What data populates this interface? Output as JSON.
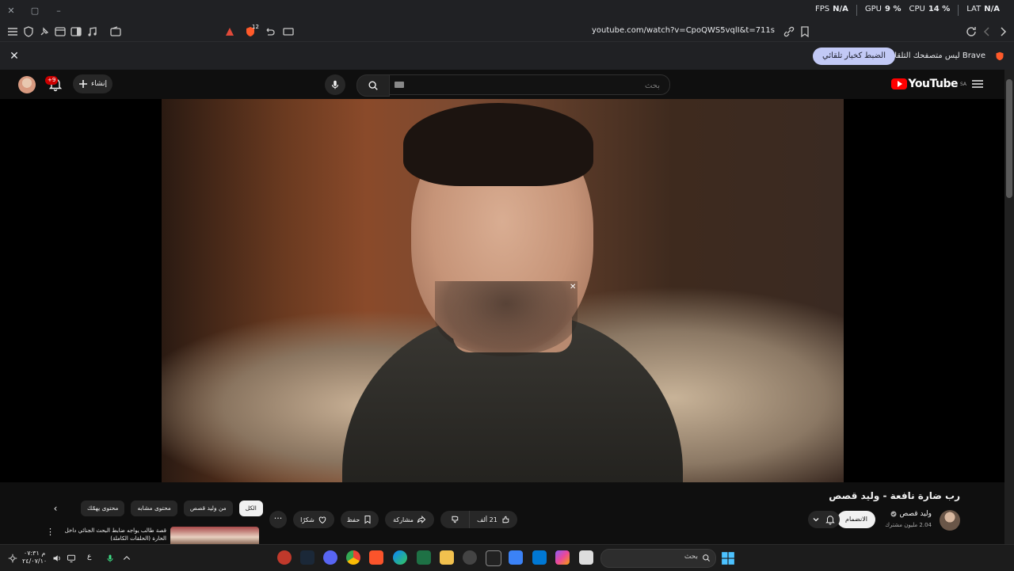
{
  "titlebar": {
    "perf": [
      {
        "label": "FPS",
        "value": "N/A"
      },
      {
        "label": "GPU",
        "value": "9 %"
      },
      {
        "label": "CPU",
        "value": "14 %"
      },
      {
        "label": "LAT",
        "value": "N/A"
      }
    ]
  },
  "toolbar": {
    "url": "youtube.com/watch?v=CpoQWS5vqlI&t=711s",
    "badge_count": "12"
  },
  "infobar": {
    "message": "Brave ليس متصفحك التلقائي.",
    "button_label": "الضبط كخيار تلقائي"
  },
  "yt_header": {
    "logo_text": "YouTube",
    "logo_region": "SA",
    "search_placeholder": "بحث",
    "create_label": "إنشاء",
    "notification_count": "+9"
  },
  "video": {
    "title": "رب ضارة نافعة - وليد قصص",
    "channel_name": "وليد قصص",
    "subscribers": "2.04 مليون مشترك",
    "join_label": "الانضمام",
    "like_count": "21 ألف",
    "share_label": "مشاركة",
    "save_label": "حفظ",
    "thanks_label": "شكرًا"
  },
  "chips": [
    "الكل",
    "من وليد قصص",
    "محتوى مشابه",
    "محتوى يهمّك"
  ],
  "recommendation": {
    "title": "قصة طالب يواجه ضابط البحث الجنائي داخل الحارة (الحلقات الكاملة)"
  },
  "taskbar": {
    "search_placeholder": "بحث",
    "time": "م ٠٧:٣١",
    "date": "٢٤/٠٧/١٠",
    "lang": "ع"
  }
}
